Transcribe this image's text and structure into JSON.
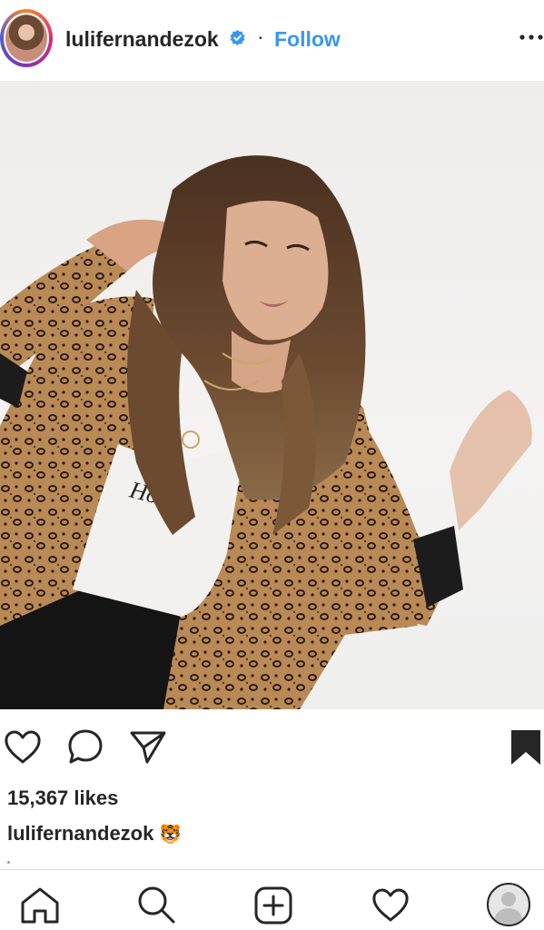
{
  "post": {
    "username": "lulifernandezok",
    "follow_label": "Follow",
    "separator": "·",
    "likes": "15,367 likes",
    "caption_user": "lulifernandezok",
    "caption_emoji": "🐯"
  },
  "photo": {
    "shirt_text": "Honey"
  },
  "icons": {
    "header": [
      "avatar",
      "verified-badge-icon",
      "more-options-icon"
    ],
    "actions": [
      "heart-icon",
      "comment-icon",
      "share-icon",
      "bookmark-icon"
    ],
    "tabbar": [
      "home-icon",
      "search-icon",
      "add-post-icon",
      "activity-heart-icon",
      "profile-avatar"
    ]
  },
  "colors": {
    "follow": "#3897f0",
    "verified": "#3897f0",
    "text": "#262626",
    "divider": "#dbdbdb"
  }
}
